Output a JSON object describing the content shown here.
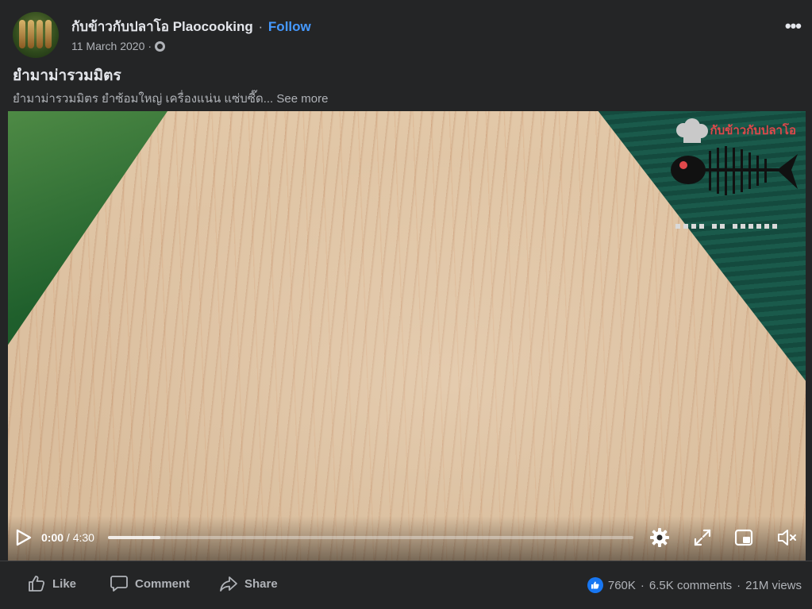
{
  "header": {
    "page_name": "กับข้าวกับปลาโอ Plaocooking",
    "separator": "·",
    "follow_label": "Follow",
    "date": "11 March 2020",
    "date_separator": "·",
    "more_label": "•••",
    "title": "ยำมาม่ารวมมิตร",
    "text": "ยำมาม่ารวมมิตร ยำซ้อมใหญ่ เครื่องแน่น แซ่บซี๊ด...",
    "see_more_label": "See more"
  },
  "video": {
    "watermark_text": "กับข้าวกับปลาโอ",
    "current_time": "0:00",
    "time_separator": "/",
    "duration": "4:30",
    "progress_fraction": 0.0,
    "buffered_fraction": 0.1,
    "icons": [
      "play-icon",
      "settings-icon",
      "fullscreen-icon",
      "miniplayer-icon",
      "muted-volume-icon"
    ]
  },
  "footer": {
    "like_label": "Like",
    "comment_label": "Comment",
    "share_label": "Share",
    "reactions": "760K",
    "comments": "6.5K comments",
    "dot": "·",
    "views": "21M views"
  },
  "colors": {
    "background": "#242526",
    "text_primary": "#e4e6eb",
    "text_secondary": "#b0b3b8",
    "follow_blue": "#4599ff",
    "like_blue": "#1877f2"
  }
}
